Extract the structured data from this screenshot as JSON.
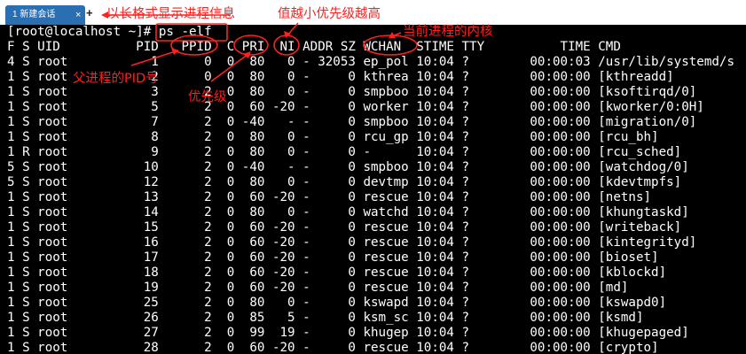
{
  "tab": {
    "label": "1 新建会话",
    "close_glyph": "×",
    "add_glyph": "+"
  },
  "terminal": {
    "lines": [
      "[root@localhost ~]# ps -elf",
      "F S UID          PID   PPID  C PRI  NI ADDR SZ WCHAN  STIME TTY          TIME CMD",
      "4 S root           1      0  0  80   0 - 32053 ep_pol 10:04 ?        00:00:03 /usr/lib/systemd/s",
      "1 S root           2      0  0  80   0 -     0 kthrea 10:04 ?        00:00:00 [kthreadd]",
      "1 S root           3      2  0  80   0 -     0 smpboo 10:04 ?        00:00:00 [ksoftirqd/0]",
      "1 S root           5      2  0  60 -20 -     0 worker 10:04 ?        00:00:00 [kworker/0:0H]",
      "1 S root           7      2  0 -40   - -     0 smpboo 10:04 ?        00:00:00 [migration/0]",
      "1 S root           8      2  0  80   0 -     0 rcu_gp 10:04 ?        00:00:00 [rcu_bh]",
      "1 R root           9      2  0  80   0 -     0 -      10:04 ?        00:00:00 [rcu_sched]",
      "5 S root          10      2  0 -40   - -     0 smpboo 10:04 ?        00:00:00 [watchdog/0]",
      "5 S root          12      2  0  80   0 -     0 devtmp 10:04 ?        00:00:00 [kdevtmpfs]",
      "1 S root          13      2  0  60 -20 -     0 rescue 10:04 ?        00:00:00 [netns]",
      "1 S root          14      2  0  80   0 -     0 watchd 10:04 ?        00:00:00 [khungtaskd]",
      "1 S root          15      2  0  60 -20 -     0 rescue 10:04 ?        00:00:00 [writeback]",
      "1 S root          16      2  0  60 -20 -     0 rescue 10:04 ?        00:00:00 [kintegrityd]",
      "1 S root          17      2  0  60 -20 -     0 rescue 10:04 ?        00:00:00 [bioset]",
      "1 S root          18      2  0  60 -20 -     0 rescue 10:04 ?        00:00:00 [kblockd]",
      "1 S root          19      2  0  60 -20 -     0 rescue 10:04 ?        00:00:00 [md]",
      "1 S root          25      2  0  80   0 -     0 kswapd 10:04 ?        00:00:00 [kswapd0]",
      "1 S root          26      2  0  85   5 -     0 ksm_sc 10:04 ?        00:00:00 [ksmd]",
      "1 S root          27      2  0  99  19 -     0 khugep 10:04 ?        00:00:00 [khugepaged]",
      "1 S root          28      2  0  60 -20 -     0 rescue 10:04 ?        00:00:00 [crypto]"
    ]
  },
  "annotations": {
    "long_format": "以长格式显示进程信息",
    "nice_priority": "值越小优先级越高",
    "current_kernel": "当前进程的内核",
    "parent_pid": "父进程的PID号",
    "priority": "优先级"
  },
  "colors": {
    "annotation": "#ff2020",
    "tab_active": "#2b6fb3",
    "terminal_bg": "#000000",
    "terminal_fg": "#ffffff"
  }
}
